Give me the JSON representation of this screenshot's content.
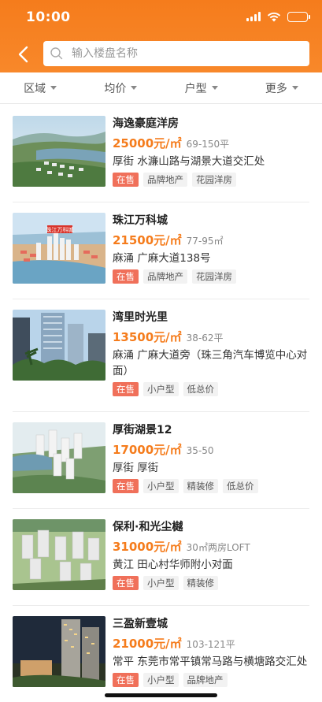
{
  "status_bar": {
    "time": "10:00"
  },
  "search": {
    "placeholder": "输入楼盘名称"
  },
  "filters": [
    {
      "label": "区域"
    },
    {
      "label": "均价"
    },
    {
      "label": "户型"
    },
    {
      "label": "更多"
    }
  ],
  "listings": [
    {
      "name": "海逸豪庭洋房",
      "price": "25000元/㎡",
      "area": "69-150平",
      "address": "厚街 水濂山路与湖景大道交汇处",
      "tags": [
        "在售",
        "品牌地产",
        "花园洋房"
      ],
      "image": "resort-aerial"
    },
    {
      "name": "珠江万科城",
      "price": "21500元/㎡",
      "area": "77-95㎡",
      "address": "麻涌 广麻大道138号",
      "tags": [
        "在售",
        "品牌地产",
        "花园洋房"
      ],
      "image": "city-aerial",
      "image_label": "珠江万科城"
    },
    {
      "name": "湾里时光里",
      "price": "13500元/㎡",
      "area": "38-62平",
      "address": "麻涌  广麻大道旁（珠三角汽车博览中心对面）",
      "tags": [
        "在售",
        "小户型",
        "低总价"
      ],
      "image": "towers"
    },
    {
      "name": "厚街湖景12",
      "price": "17000元/㎡",
      "area": "35-50",
      "address": "厚街 厚街",
      "tags": [
        "在售",
        "小户型",
        "精装修",
        "低总价"
      ],
      "image": "lake-towers"
    },
    {
      "name": "保利·和光尘樾",
      "price": "31000元/㎡",
      "area": "30㎡两房LOFT",
      "address": "黄江 田心村华师附小对面",
      "tags": [
        "在售",
        "小户型",
        "精装修"
      ],
      "image": "estate-aerial"
    },
    {
      "name": "三盈新壹城",
      "price": "21000元/㎡",
      "area": "103-121平",
      "address": "常平 东莞市常平镇常马路与横塘路交汇处",
      "tags": [
        "在售",
        "小户型",
        "品牌地产"
      ],
      "image": "tower-night"
    }
  ],
  "colors": {
    "accent": "#f57c1c",
    "onsale_tag": "#f0705a"
  }
}
